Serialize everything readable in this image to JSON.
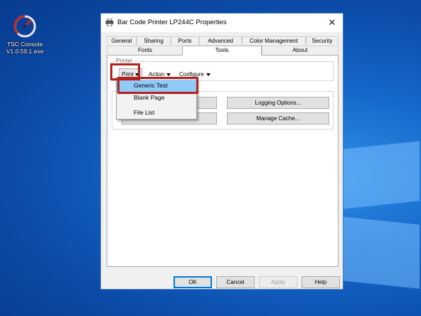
{
  "desktop": {
    "icon_label_line1": "TSC Console",
    "icon_label_line2": "V1.0.59.1.exe",
    "icon_name": "tsc-console-icon"
  },
  "window": {
    "title": "Bar Code Printer LP244C Properties",
    "close_glyph": "✕"
  },
  "tabs": {
    "row1": [
      "General",
      "Sharing",
      "Ports",
      "Advanced",
      "Color Management",
      "Security"
    ],
    "row2": [
      "Fonts",
      "Tools",
      "About"
    ],
    "active": "Tools"
  },
  "tools": {
    "printer_group_label": "Printer",
    "print_menu": "Print",
    "action_menu": "Action",
    "configure_menu": "Configure",
    "logging_options": "Logging Options...",
    "manage_cache": "Manage Cache..."
  },
  "print_dropdown": {
    "items": [
      "Generic Test",
      "Blank Page",
      "File List"
    ],
    "highlighted": "Generic Test"
  },
  "footer": {
    "ok": "OK",
    "cancel": "Cancel",
    "apply": "Apply",
    "help": "Help"
  },
  "colors": {
    "highlight_box": "#b5221e",
    "menu_hover": "#91c9f7",
    "default_button_border": "#0078d7"
  }
}
